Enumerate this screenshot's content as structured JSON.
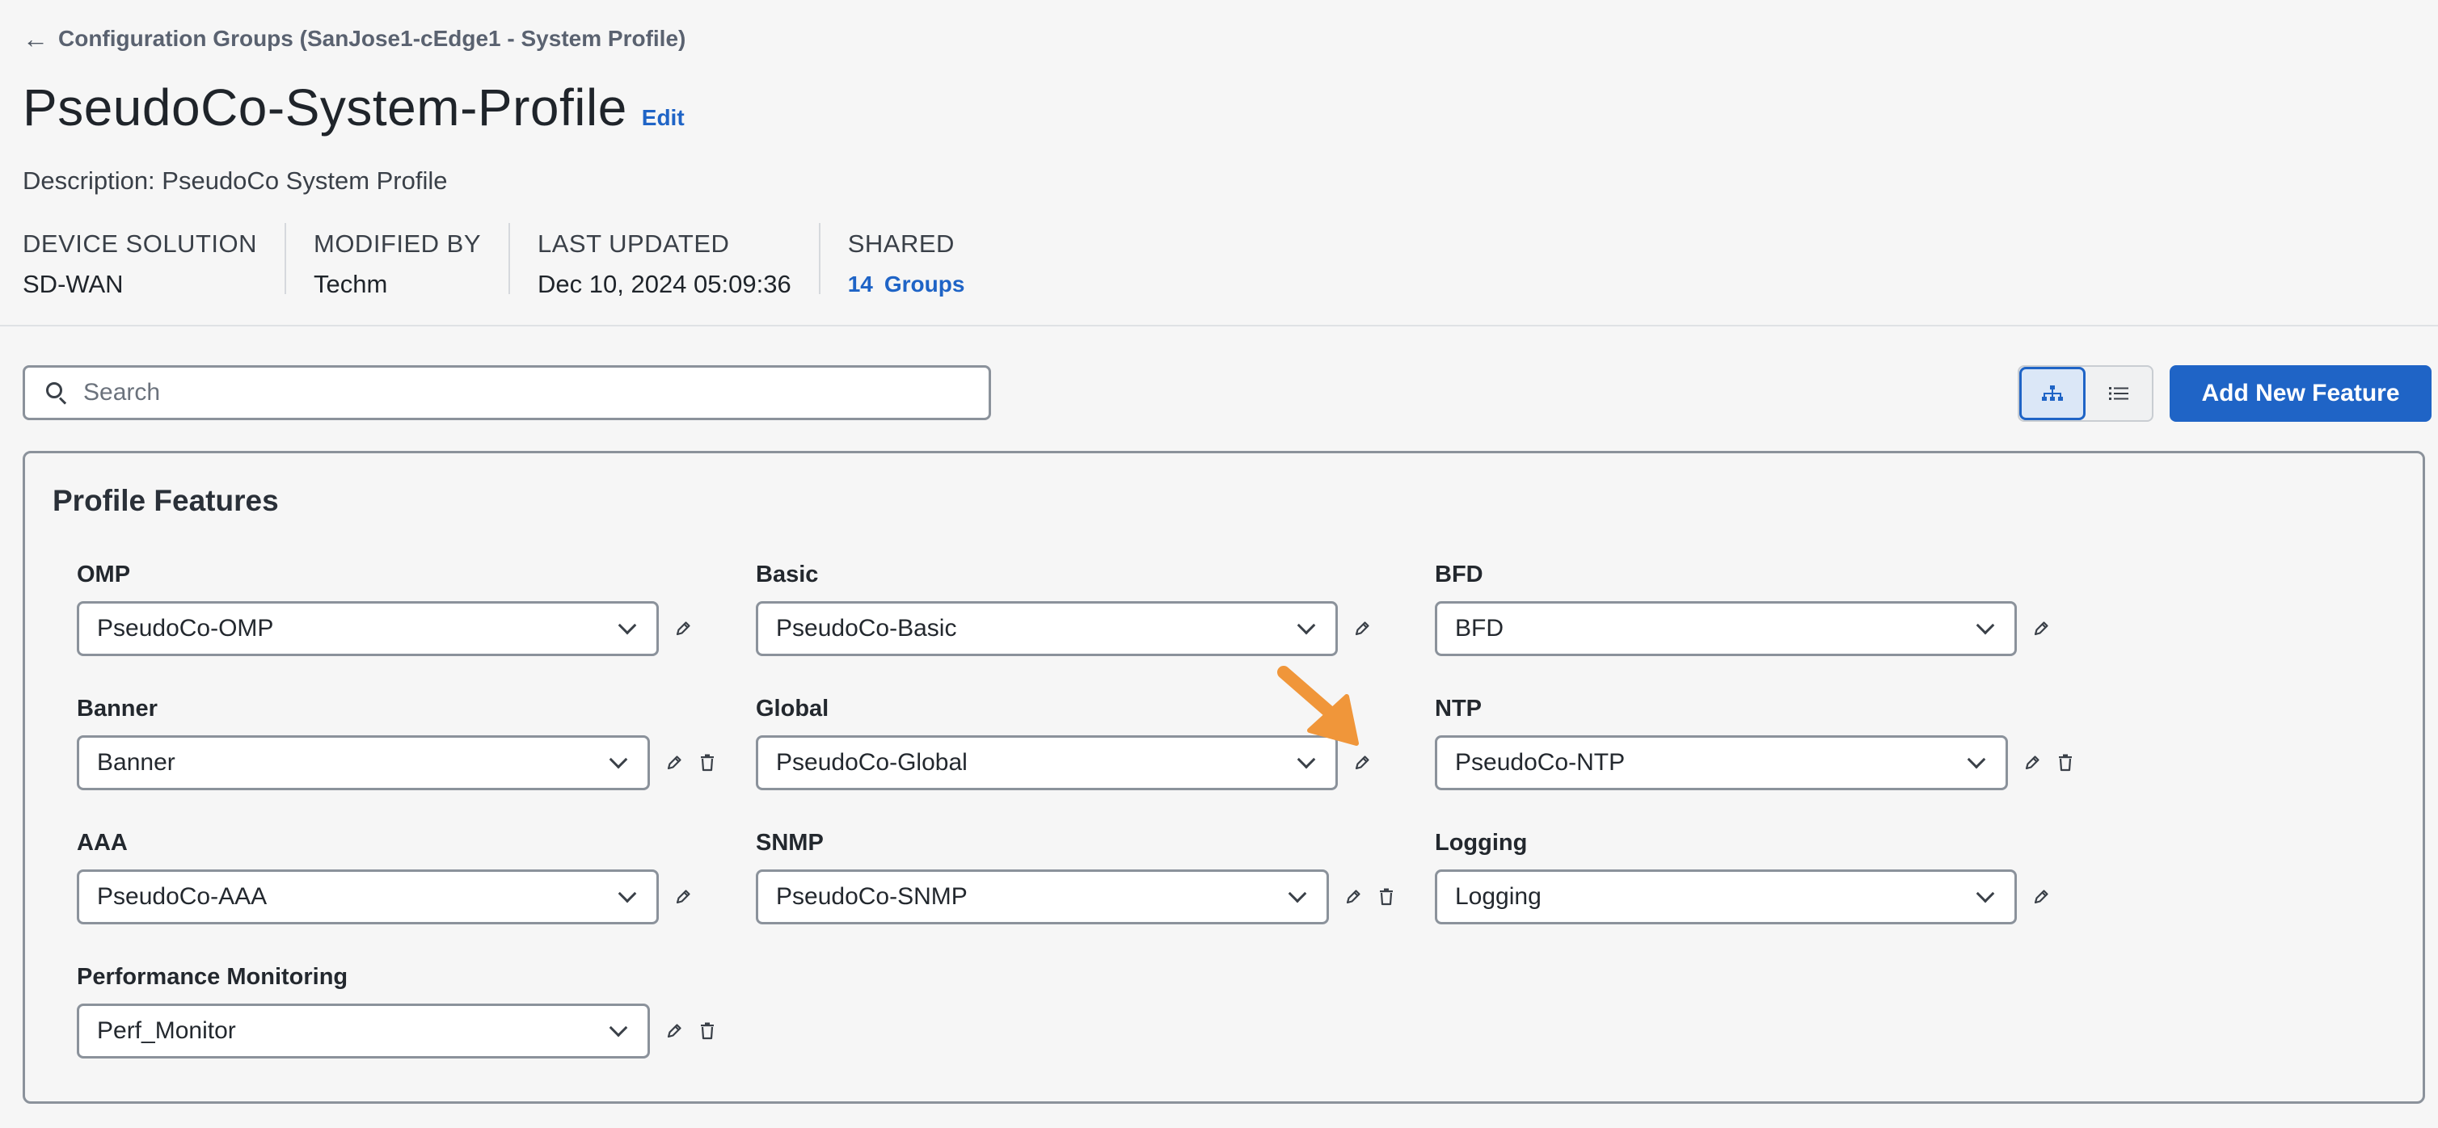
{
  "breadcrumb": {
    "label": "Configuration Groups (SanJose1-cEdge1 - System Profile)"
  },
  "header": {
    "title": "PseudoCo-System-Profile",
    "edit_label": "Edit",
    "description": "Description: PseudoCo System Profile"
  },
  "meta": {
    "device_solution": {
      "label": "DEVICE SOLUTION",
      "value": "SD-WAN"
    },
    "modified_by": {
      "label": "MODIFIED BY",
      "value": "Techm"
    },
    "last_updated": {
      "label": "LAST UPDATED",
      "value": "Dec 10, 2024 05:09:36"
    },
    "shared": {
      "label": "SHARED",
      "count": "14",
      "unit": "Groups"
    }
  },
  "search": {
    "placeholder": "Search",
    "value": ""
  },
  "toolbar": {
    "add_label": "Add New Feature"
  },
  "colors": {
    "accent": "#1f64c6",
    "annotation": "#f0963a",
    "border": "#8b929b"
  },
  "card": {
    "title": "Profile Features",
    "features": [
      {
        "label": "OMP",
        "value": "PseudoCo-OMP",
        "edit": true,
        "delete": false
      },
      {
        "label": "Basic",
        "value": "PseudoCo-Basic",
        "edit": true,
        "delete": false
      },
      {
        "label": "BFD",
        "value": "BFD",
        "edit": true,
        "delete": false
      },
      {
        "label": "Banner",
        "value": "Banner",
        "edit": true,
        "delete": true
      },
      {
        "label": "Global",
        "value": "PseudoCo-Global",
        "edit": true,
        "delete": false
      },
      {
        "label": "NTP",
        "value": "PseudoCo-NTP",
        "edit": true,
        "delete": true
      },
      {
        "label": "AAA",
        "value": "PseudoCo-AAA",
        "edit": true,
        "delete": false
      },
      {
        "label": "SNMP",
        "value": "PseudoCo-SNMP",
        "edit": true,
        "delete": true
      },
      {
        "label": "Logging",
        "value": "Logging",
        "edit": true,
        "delete": false
      },
      {
        "label": "Performance Monitoring",
        "value": "Perf_Monitor",
        "edit": true,
        "delete": true
      }
    ]
  }
}
